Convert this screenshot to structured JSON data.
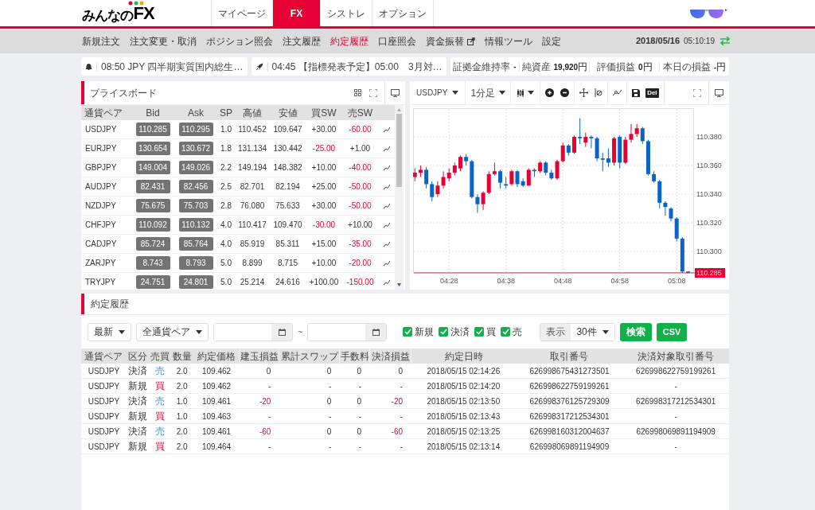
{
  "header": {
    "logo": {
      "text": "みんなの",
      "emphasis": "FX"
    },
    "tabs": [
      {
        "label": "マイページ",
        "selected": false
      },
      {
        "label": "FX",
        "selected": true
      },
      {
        "label": "シストレ",
        "selected": false
      },
      {
        "label": "オプション",
        "selected": false
      }
    ]
  },
  "nav": {
    "items": [
      {
        "label": "新規注文",
        "selected": false
      },
      {
        "label": "注文変更・取消",
        "selected": false
      },
      {
        "label": "ポジション照会",
        "selected": false
      },
      {
        "label": "注文履歴",
        "selected": false
      },
      {
        "label": "約定履歴",
        "selected": true
      },
      {
        "label": "口座照会",
        "selected": false
      },
      {
        "label": "資金振替",
        "selected": false,
        "external": true
      },
      {
        "label": "情報ツール",
        "selected": false
      },
      {
        "label": "設定",
        "selected": false
      }
    ],
    "date": "2018/05/16",
    "time": "05:10:19"
  },
  "tickers": [
    {
      "kind": "bell",
      "text": "08:50 JPY 四半期実質国内総生…"
    },
    {
      "kind": "rocket",
      "text": "04:45 【指標発表予定】05:00　3月対…"
    }
  ],
  "account": [
    {
      "label": "証拠金維持率",
      "value": "-"
    },
    {
      "label": "純資産",
      "value": "19,920",
      "unit": "円"
    },
    {
      "label": "評価損益",
      "value": "0",
      "unit": "円"
    },
    {
      "label": "本日の損益",
      "value": "-",
      "unit": "円"
    }
  ],
  "price_board": {
    "title": "プライスボード",
    "columns": [
      "通貨ペア",
      "Bid",
      "Ask",
      "SP",
      "高値",
      "安値",
      "買SW",
      "売SW"
    ],
    "rows": [
      {
        "pair": "USDJPY",
        "bid": "110.285",
        "ask": "110.295",
        "sp": "1.0",
        "high": "110.452",
        "low": "109.647",
        "buy_sw": {
          "text": "+30.00",
          "negative": false
        },
        "sell_sw": {
          "text": "-60.00",
          "negative": true
        }
      },
      {
        "pair": "EURJPY",
        "bid": "130.654",
        "ask": "130.672",
        "sp": "1.8",
        "high": "131.134",
        "low": "130.442",
        "buy_sw": {
          "text": "-25.00",
          "negative": true
        },
        "sell_sw": {
          "text": "+1.00",
          "negative": false
        }
      },
      {
        "pair": "GBPJPY",
        "bid": "149.004",
        "ask": "149.026",
        "sp": "2.2",
        "high": "149.194",
        "low": "148.382",
        "buy_sw": {
          "text": "+10.00",
          "negative": false
        },
        "sell_sw": {
          "text": "-40.00",
          "negative": true
        }
      },
      {
        "pair": "AUDJPY",
        "bid": "82.431",
        "ask": "82.456",
        "sp": "2.5",
        "high": "82.701",
        "low": "82.194",
        "buy_sw": {
          "text": "+25.00",
          "negative": false
        },
        "sell_sw": {
          "text": "-50.00",
          "negative": true
        }
      },
      {
        "pair": "NZDJPY",
        "bid": "75.675",
        "ask": "75.703",
        "sp": "2.8",
        "high": "76.080",
        "low": "75.633",
        "buy_sw": {
          "text": "+30.00",
          "negative": false
        },
        "sell_sw": {
          "text": "-50.00",
          "negative": true
        }
      },
      {
        "pair": "CHFJPY",
        "bid": "110.092",
        "ask": "110.132",
        "sp": "4.0",
        "high": "110.417",
        "low": "109.470",
        "buy_sw": {
          "text": "-30.00",
          "negative": true
        },
        "sell_sw": {
          "text": "+10.00",
          "negative": false
        }
      },
      {
        "pair": "CADJPY",
        "bid": "85.724",
        "ask": "85.764",
        "sp": "4.0",
        "high": "85.919",
        "low": "85.311",
        "buy_sw": {
          "text": "+15.00",
          "negative": false
        },
        "sell_sw": {
          "text": "-35.00",
          "negative": true
        }
      },
      {
        "pair": "ZARJPY",
        "bid": "8.743",
        "ask": "8.793",
        "sp": "5.0",
        "high": "8.899",
        "low": "8.715",
        "buy_sw": {
          "text": "+10.00",
          "negative": false
        },
        "sell_sw": {
          "text": "-20.00",
          "negative": true
        }
      },
      {
        "pair": "TRYJPY",
        "bid": "24.751",
        "ask": "24.801",
        "sp": "5.0",
        "high": "25.214",
        "low": "24.616",
        "buy_sw": {
          "text": "+100.00",
          "negative": false
        },
        "sell_sw": {
          "text": "-150.00",
          "negative": true
        }
      }
    ]
  },
  "chart": {
    "symbol": "USDJPY",
    "interval": "1分足",
    "delete_label": "Del",
    "last_price": "110.285",
    "chart_data": {
      "type": "candlestick",
      "categories": [
        null,
        null,
        null,
        null,
        null,
        null,
        "04:28",
        null,
        null,
        null,
        null,
        null,
        null,
        null,
        null,
        null,
        "04:38",
        null,
        null,
        null,
        null,
        null,
        null,
        null,
        null,
        null,
        "04:48",
        null,
        null,
        null,
        null,
        null,
        null,
        null,
        null,
        null,
        "04:58",
        null,
        null,
        null,
        null,
        null,
        null,
        null,
        null,
        null,
        "05:08",
        null,
        null
      ],
      "ylim": [
        110.2856,
        110.4
      ],
      "grid": true,
      "ohlc": [
        [
          110.352,
          110.358,
          110.349,
          110.355
        ],
        [
          110.355,
          110.36,
          110.352,
          110.357
        ],
        [
          110.357,
          110.359,
          110.344,
          110.347
        ],
        [
          110.347,
          110.349,
          110.335,
          110.338
        ],
        [
          110.34,
          110.349,
          110.338,
          110.346
        ],
        [
          110.346,
          110.356,
          110.344,
          110.352
        ],
        [
          110.351,
          110.358,
          110.349,
          110.355
        ],
        [
          110.355,
          110.362,
          110.353,
          110.36
        ],
        [
          110.358,
          110.367,
          110.356,
          110.366
        ],
        [
          110.366,
          110.368,
          110.36,
          110.363
        ],
        [
          110.363,
          110.364,
          110.337,
          110.338
        ],
        [
          110.338,
          110.34,
          110.327,
          110.333
        ],
        [
          110.333,
          110.342,
          110.329,
          110.341
        ],
        [
          110.341,
          110.356,
          110.34,
          110.354
        ],
        [
          110.354,
          110.362,
          110.353,
          110.356
        ],
        [
          110.356,
          110.357,
          110.344,
          110.348
        ],
        [
          110.347,
          110.352,
          110.344,
          110.346
        ],
        [
          110.347,
          110.357,
          110.346,
          110.356
        ],
        [
          110.356,
          110.357,
          110.345,
          110.347
        ],
        [
          110.349,
          110.351,
          110.345,
          110.346
        ],
        [
          110.346,
          110.358,
          110.346,
          110.357
        ],
        [
          110.357,
          110.358,
          110.352,
          110.356
        ],
        [
          110.356,
          110.363,
          110.355,
          110.362
        ],
        [
          110.362,
          110.363,
          110.353,
          110.355
        ],
        [
          110.355,
          110.357,
          110.35,
          110.351
        ],
        [
          110.351,
          110.364,
          110.35,
          110.363
        ],
        [
          110.363,
          110.376,
          110.362,
          110.374
        ],
        [
          110.374,
          110.375,
          110.367,
          110.369
        ],
        [
          110.369,
          110.381,
          110.368,
          110.38
        ],
        [
          110.38,
          110.393,
          110.375,
          110.379
        ],
        [
          110.376,
          110.383,
          110.373,
          110.38
        ],
        [
          110.38,
          110.381,
          110.372,
          110.379
        ],
        [
          110.379,
          110.38,
          110.363,
          110.365
        ],
        [
          110.365,
          110.369,
          110.356,
          110.364
        ],
        [
          110.365,
          110.372,
          110.359,
          110.362
        ],
        [
          110.362,
          110.38,
          110.36,
          110.379
        ],
        [
          110.38,
          110.381,
          110.358,
          110.362
        ],
        [
          110.362,
          110.38,
          110.361,
          110.378
        ],
        [
          110.378,
          110.389,
          110.376,
          110.382
        ],
        [
          110.382,
          110.389,
          110.38,
          110.386
        ],
        [
          110.386,
          110.387,
          110.375,
          110.377
        ],
        [
          110.377,
          110.378,
          110.353,
          110.354
        ],
        [
          110.354,
          110.356,
          110.348,
          110.349
        ],
        [
          110.349,
          110.35,
          110.33,
          110.334
        ],
        [
          110.334,
          110.335,
          110.325,
          110.331
        ],
        [
          110.33,
          110.331,
          110.321,
          110.323
        ],
        [
          110.323,
          110.324,
          110.307,
          110.309
        ],
        [
          110.309,
          110.31,
          110.285,
          110.286
        ],
        [
          110.286,
          110.286,
          110.285,
          110.285
        ]
      ],
      "yticks": [
        {
          "value": 110.38,
          "label": "110.380"
        },
        {
          "value": 110.36,
          "label": "110.360"
        },
        {
          "value": 110.34,
          "label": "110.340"
        },
        {
          "value": 110.32,
          "label": "110.320"
        },
        {
          "value": 110.3,
          "label": "110.300"
        }
      ]
    }
  },
  "history": {
    "title": "約定履歴",
    "filters": {
      "order": "最新",
      "pair": "全通貨ペア",
      "range_separator": "~",
      "checkboxes": [
        {
          "label": "新規",
          "checked": true
        },
        {
          "label": "決済",
          "checked": true
        },
        {
          "label": "買",
          "checked": true
        },
        {
          "label": "売",
          "checked": true
        }
      ],
      "display_label": "表示",
      "count": "30件",
      "search": "検索",
      "csv": "CSV"
    },
    "columns": [
      "通貨ペア",
      "区分",
      "売買",
      "数量",
      "約定価格",
      "建玉損益",
      "累計スワップ",
      "手数料",
      "決済損益",
      "約定日時",
      "取引番号",
      "決済対象取引番号"
    ],
    "rows": [
      {
        "pair": "USDJPY",
        "type": "決済",
        "side": {
          "text": "売",
          "kind": "sell"
        },
        "qty": "2.0",
        "price": "109.462",
        "position_pl": {
          "text": "0",
          "negative": false
        },
        "swap": "0",
        "fee": "0",
        "settle_pl": {
          "text": "0",
          "negative": false
        },
        "datetime": "2018/05/15 02:14:26",
        "trade_no": "626998675431273501",
        "target_no": "626998622759199261"
      },
      {
        "pair": "USDJPY",
        "type": "新規",
        "side": {
          "text": "買",
          "kind": "buy"
        },
        "qty": "2.0",
        "price": "109.462",
        "position_pl": {
          "text": "-",
          "negative": false
        },
        "swap": "-",
        "fee": "-",
        "settle_pl": {
          "text": "-",
          "negative": false
        },
        "datetime": "2018/05/15 02:14:20",
        "trade_no": "626998622759199261",
        "target_no": "-"
      },
      {
        "pair": "USDJPY",
        "type": "決済",
        "side": {
          "text": "売",
          "kind": "sell"
        },
        "qty": "1.0",
        "price": "109.461",
        "position_pl": {
          "text": "-20",
          "negative": true
        },
        "swap": "0",
        "fee": "0",
        "settle_pl": {
          "text": "-20",
          "negative": true
        },
        "datetime": "2018/05/15 02:13:50",
        "trade_no": "626998376125729309",
        "target_no": "626998317212534301"
      },
      {
        "pair": "USDJPY",
        "type": "新規",
        "side": {
          "text": "買",
          "kind": "buy"
        },
        "qty": "1.0",
        "price": "109.463",
        "position_pl": {
          "text": "-",
          "negative": false
        },
        "swap": "-",
        "fee": "-",
        "settle_pl": {
          "text": "-",
          "negative": false
        },
        "datetime": "2018/05/15 02:13:43",
        "trade_no": "626998317212534301",
        "target_no": "-"
      },
      {
        "pair": "USDJPY",
        "type": "決済",
        "side": {
          "text": "売",
          "kind": "sell"
        },
        "qty": "2.0",
        "price": "109.461",
        "position_pl": {
          "text": "-60",
          "negative": true
        },
        "swap": "0",
        "fee": "0",
        "settle_pl": {
          "text": "-60",
          "negative": true
        },
        "datetime": "2018/05/15 02:13:25",
        "trade_no": "626998160312004637",
        "target_no": "626998069891194909"
      },
      {
        "pair": "USDJPY",
        "type": "新規",
        "side": {
          "text": "買",
          "kind": "buy"
        },
        "qty": "2.0",
        "price": "109.464",
        "position_pl": {
          "text": "-",
          "negative": false
        },
        "swap": "-",
        "fee": "-",
        "settle_pl": {
          "text": "-",
          "negative": false
        },
        "datetime": "2018/05/15 02:13:14",
        "trade_no": "626998069891194909",
        "target_no": "-"
      }
    ]
  }
}
